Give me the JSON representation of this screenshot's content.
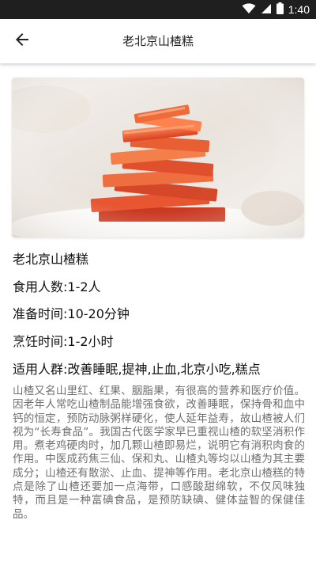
{
  "status_bar": {
    "time": "1:40",
    "icons": [
      "wifi-icon",
      "signal-icon",
      "battery-icon"
    ],
    "background": "#1f1f1f"
  },
  "header": {
    "title": "老北京山楂糕",
    "back_icon": "back-arrow-icon"
  },
  "recipe": {
    "name": "老北京山楂糕",
    "servings": "食用人数:1-2人",
    "prep_time": "准备时间:10-20分钟",
    "cook_time": "烹饪时间:1-2小时",
    "suitable": "适用人群:改善睡眠,提神,止血,北京小吃,糕点",
    "description": "山楂又名山里红、红果、胭脂果，有很高的营养和医疗价值。因老年人常吃山楂制品能增强食欲，改善睡眠，保持骨和血中钙的恒定，预防动脉粥样硬化，使人延年益寿，故山楂被人们视为“长寿食品”。我国古代医学家早已重视山楂的软坚消积作用。煮老鸡硬肉时，加几颗山楂即易烂，说明它有消积肉食的作用。中医成药焦三仙、保和丸、山楂丸等均以山楂为其主要成分；山楂还有散淤、止血、提神等作用。老北京山楂糕的特点是除了山楂还要加一点海带，口感酸甜绵软，不仅风味独特，而且是一种富碘食品，是预防缺碘、健体益智的保健佳品。"
  },
  "colors": {
    "text_primary": "#111111",
    "text_secondary": "#6f6f6f",
    "accent_food": "#e8502a"
  }
}
